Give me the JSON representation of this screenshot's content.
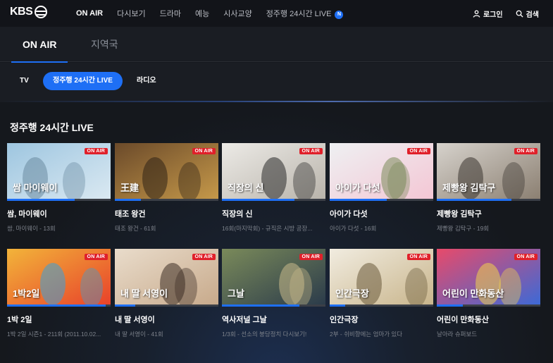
{
  "brand": {
    "logo_text": "KBS"
  },
  "nav": {
    "items": [
      {
        "label": "ON AIR",
        "active": true
      },
      {
        "label": "다시보기"
      },
      {
        "label": "드라마"
      },
      {
        "label": "예능"
      },
      {
        "label": "시사교양"
      },
      {
        "label": "정주행 24시간 LIVE",
        "badge": "N"
      }
    ],
    "login_label": "로그인",
    "search_label": "검색"
  },
  "main_tabs": [
    {
      "label": "ON AIR",
      "active": true
    },
    {
      "label": "지역국"
    }
  ],
  "sub_tabs": [
    {
      "label": "TV"
    },
    {
      "label": "정주행 24시간 LIVE",
      "active": true
    },
    {
      "label": "라디오"
    }
  ],
  "section": {
    "title": "정주행 24시간 LIVE"
  },
  "onair_label": "ON AIR",
  "colors": {
    "accent": "#1e6ff5",
    "onair": "#e0202a",
    "background": "#15181d"
  },
  "cards": [
    {
      "title": "쌈, 마이웨이",
      "subtitle": "쌈, 마이웨이 - 13회",
      "progress": 0.65,
      "thumb_text": "쌈 마이웨이",
      "palette": [
        "#9ec6e0",
        "#dbe9f2",
        "#6a8aa0"
      ]
    },
    {
      "title": "태조 왕건",
      "subtitle": "태조 왕건 - 61회",
      "progress": 0.25,
      "thumb_text": "王建",
      "palette": [
        "#6b4a2a",
        "#c79a4a",
        "#2f2216"
      ]
    },
    {
      "title": "직장의 신",
      "subtitle": "16회(마지막회) - 규직은 시방 공장...",
      "progress": 0.7,
      "thumb_text": "직장의 신",
      "palette": [
        "#eceae6",
        "#b8b3aa",
        "#2a2a2a"
      ]
    },
    {
      "title": "아이가 다섯",
      "subtitle": "아이가 다섯 - 16회",
      "progress": 0.55,
      "thumb_text": "아이가 다섯",
      "palette": [
        "#eef0f2",
        "#f4c6d4",
        "#7a8a5a"
      ]
    },
    {
      "title": "제빵왕 김탁구",
      "subtitle": "제빵왕 김탁구 - 19회",
      "progress": 0.72,
      "thumb_text": "제빵왕 김탁구",
      "palette": [
        "#d6d2cc",
        "#8a7e70",
        "#3a3430"
      ]
    },
    {
      "title": "1박 2일",
      "subtitle": "1박 2일 시즌1 - 211회 (2011.10.02...",
      "progress": 0.95,
      "thumb_text": "1박2일",
      "palette": [
        "#f2b43a",
        "#e8402a",
        "#3aa0d8"
      ]
    },
    {
      "title": "내 딸 서영이",
      "subtitle": "내 딸 서영이 - 41회",
      "progress": 0.2,
      "thumb_text": "내 딸 서영이",
      "palette": [
        "#e9dccb",
        "#c7a98a",
        "#3d2d25"
      ]
    },
    {
      "title": "역사저널 그날",
      "subtitle": "1/3회 - 선소의 붕당정치 다시보기!",
      "progress": 0.75,
      "thumb_text": "그날",
      "palette": [
        "#7a8a5a",
        "#2a3a4a",
        "#c9b98a"
      ]
    },
    {
      "title": "인간극장",
      "subtitle": "2부 - 쉬비향에는 엄마가 있다",
      "progress": 0.15,
      "thumb_text": "인간극장",
      "palette": [
        "#f1ece0",
        "#c8b48a",
        "#6a5a3a"
      ]
    },
    {
      "title": "어린이 만화동산",
      "subtitle": "날아라 슈퍼보드",
      "progress": 0.25,
      "thumb_text": "어린이 만화동산",
      "palette": [
        "#e84a6a",
        "#3a6ad8",
        "#f2d24a"
      ]
    }
  ]
}
